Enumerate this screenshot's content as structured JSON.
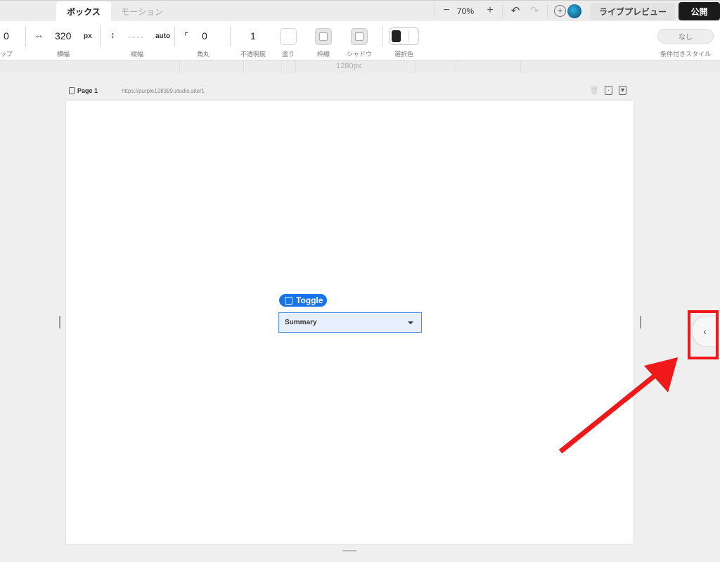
{
  "tabs": {
    "box": "ボックス",
    "motion": "モーション"
  },
  "zoom": {
    "minus": "−",
    "value": "70%",
    "plus": "+"
  },
  "history": {
    "undo": "↶",
    "redo": "↷"
  },
  "header": {
    "add_member": "+",
    "preview": "ライブプレビュー",
    "publish": "公開"
  },
  "props": {
    "gap_value": "0",
    "gap_label": "ップ",
    "width_icon": "↔",
    "width_value": "320",
    "width_unit": "px",
    "width_label": "横幅",
    "height_icon": "↕",
    "height_value": "----",
    "height_unit": "auto",
    "height_label": "縦幅",
    "radius_icon": "⌜",
    "radius_value": "0",
    "radius_label": "角丸",
    "opacity_value": "1",
    "opacity_label": "不透明度",
    "fill_label": "塗り",
    "border_label": "枠線",
    "shadow_label": "シャドウ",
    "selection_label": "選択色",
    "conditional_value": "なし",
    "conditional_label": "条件付きスタイル"
  },
  "canvas": {
    "ruler": "1280px",
    "page_name": "Page 1",
    "page_url": "https://purple128399.studio.site/1"
  },
  "elements": {
    "toggle_label": "Toggle",
    "summary_label": "Summary"
  },
  "panel": {
    "toggle_glyph": "‹"
  },
  "colors": {
    "accent": "#1a73e8",
    "highlight": "#f01818",
    "publish_bg": "#1a1a1a"
  }
}
